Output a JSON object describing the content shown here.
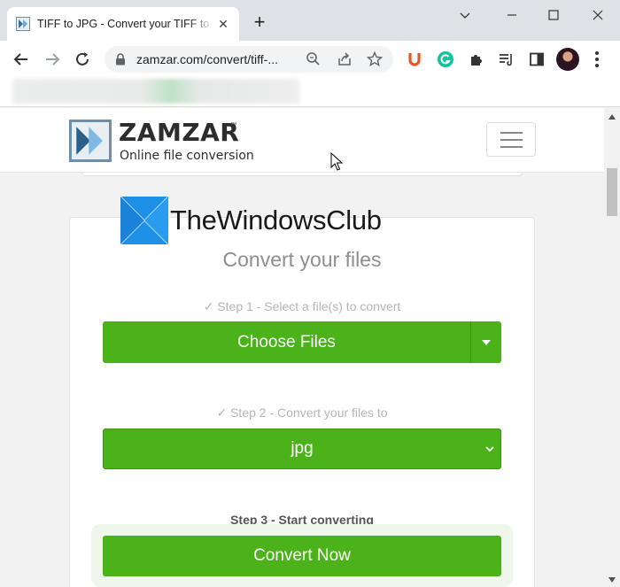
{
  "browser": {
    "tab_title": "TIFF to JPG - Convert your TIFF to JPG",
    "tab_close_icon": "close-icon",
    "new_tab_label": "+",
    "url": "zamzar.com/convert/tiff-...",
    "window_controls": [
      "minimize-icon",
      "maximize-icon",
      "close-icon"
    ]
  },
  "site": {
    "brand_name": "ZAMZAR",
    "brand_tm": "™",
    "brand_tagline": "Online file conversion",
    "watermark": "TheWindowsClub"
  },
  "converter": {
    "title": "Convert your files",
    "step1_label": "✓ Step 1 - Select a file(s) to convert",
    "choose_files_label": "Choose Files",
    "step2_label": "✓ Step 2 - Convert your files to",
    "format_value": "jpg",
    "step3_label": "Step 3 - Start converting",
    "convert_label": "Convert Now"
  },
  "colors": {
    "accent_green": "#4bb21a",
    "tab_bar": "#dee1e6"
  }
}
